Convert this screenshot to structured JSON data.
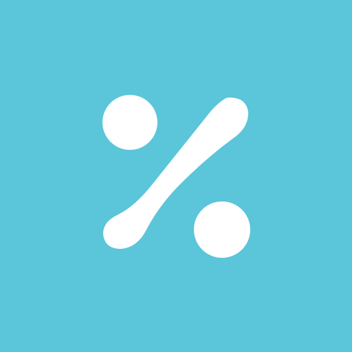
{
  "icon": {
    "name": "percent-icon",
    "background_color": "#5BC5DA",
    "glyph_color": "#FFFFFF"
  }
}
